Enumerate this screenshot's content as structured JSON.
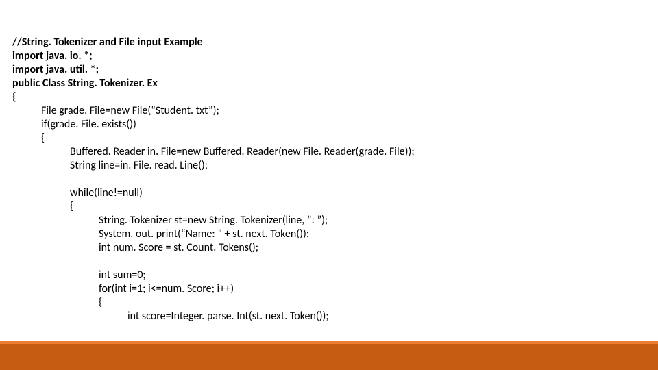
{
  "code": {
    "l01": "//String. Tokenizer and File input Example",
    "l02": "import java. io. *;",
    "l03": "import java. util. *;",
    "l04": "public Class String. Tokenizer. Ex",
    "l05": "{",
    "l06": "File grade. File=new File(“Student. txt”);",
    "l07": "if(grade. File. exists())",
    "l08": "{",
    "l09": "Buffered. Reader in. File=new Buffered. Reader(new File. Reader(grade. File));",
    "l10": "String line=in. File. read. Line();",
    "l11": "",
    "l12": "while(line!=null)",
    "l13": "{",
    "l14": "String. Tokenizer st=new String. Tokenizer(line, ”: ”);",
    "l15": "System. out. print(“Name: ” + st. next. Token());",
    "l16": "int num. Score = st. Count. Tokens();",
    "l17": "",
    "l18": "int sum=0;",
    "l19": "for(int i=1; i<=num. Score; i++)",
    "l20": "{",
    "l21": "int score=Integer. parse. Int(st. next. Token());"
  }
}
